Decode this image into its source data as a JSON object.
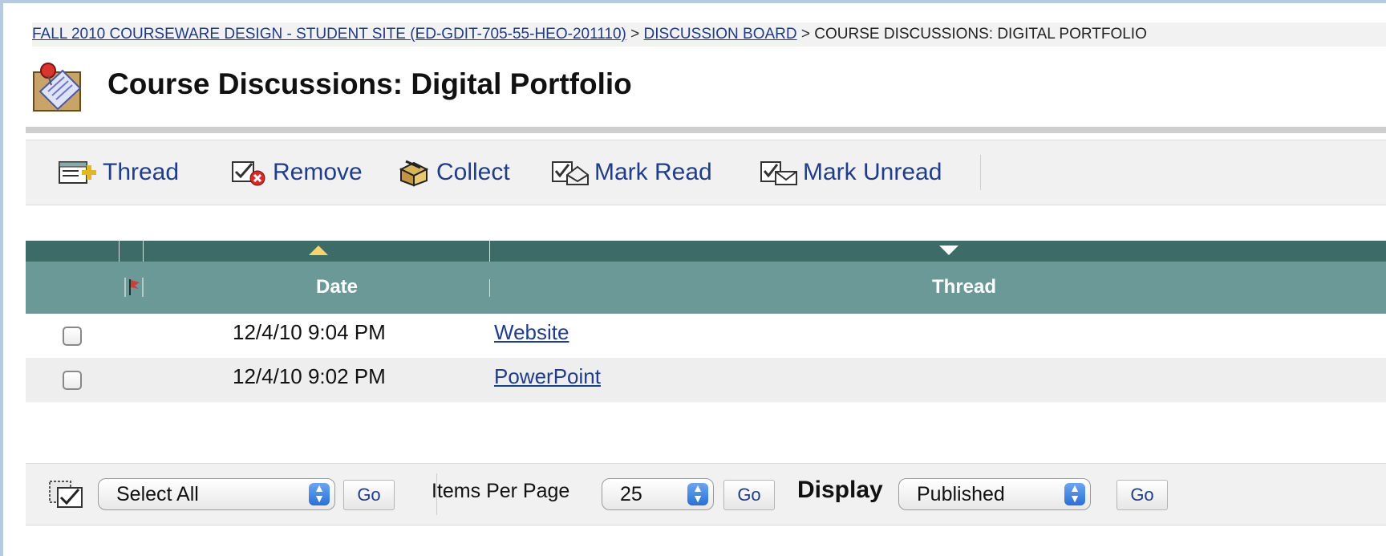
{
  "breadcrumb": {
    "course": "FALL 2010 COURSEWARE DESIGN - STUDENT SITE (ED-GDIT-705-55-HEO-201110)",
    "separator1": ">",
    "board": "DISCUSSION BOARD",
    "separator2": ">",
    "current": "COURSE DISCUSSIONS: DIGITAL PORTFOLIO"
  },
  "page": {
    "title": "Course Discussions: Digital Portfolio"
  },
  "toolbar": {
    "thread": "Thread",
    "remove": "Remove",
    "collect": "Collect",
    "mark_read": "Mark Read",
    "mark_unread": "Mark Unread"
  },
  "table": {
    "headers": {
      "date": "Date",
      "thread": "Thread"
    },
    "rows": [
      {
        "date": "12/4/10 9:04 PM",
        "thread": "Website"
      },
      {
        "date": "12/4/10 9:02 PM",
        "thread": "PowerPoint"
      }
    ]
  },
  "footer": {
    "select_all": "Select All",
    "go": "Go",
    "items_per_page_label": "Items Per Page",
    "items_per_page_value": "25",
    "display_label": "Display",
    "display_value": "Published"
  },
  "colors": {
    "header_dark": "#3d6b68",
    "header_light": "#6a9997",
    "link": "#1f3d8c",
    "sort_up": "#f6d36b"
  }
}
